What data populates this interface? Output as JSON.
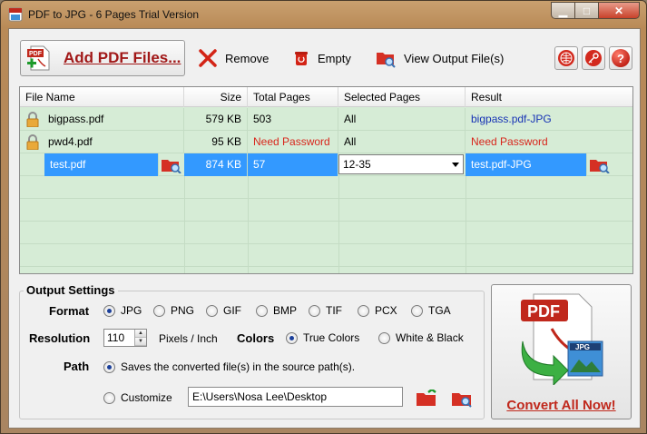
{
  "window": {
    "title": "PDF to JPG - 6 Pages Trial Version",
    "minimize_glyph": "▁",
    "maximize_glyph": "□",
    "close_glyph": "✕"
  },
  "toolbar": {
    "add_label": "Add PDF Files...",
    "remove_label": "Remove",
    "empty_label": "Empty",
    "view_output_label": "View Output File(s)",
    "help_glyph": "?"
  },
  "table": {
    "columns": [
      "File Name",
      "Size",
      "Total Pages",
      "Selected Pages",
      "Result"
    ],
    "rows": [
      {
        "file": "bigpass.pdf",
        "size": "579 KB",
        "total": "503",
        "selected": "All",
        "result": "bigpass.pdf-JPG",
        "locked": true
      },
      {
        "file": "pwd4.pdf",
        "size": "95 KB",
        "total": "Need Password",
        "selected": "All",
        "result": "Need Password",
        "locked": true
      },
      {
        "file": "test.pdf",
        "size": "874 KB",
        "total": "57",
        "selected": "12-35",
        "result": "test.pdf-JPG",
        "locked": false
      }
    ]
  },
  "settings": {
    "title": "Output Settings",
    "format_label": "Format",
    "formats": [
      "JPG",
      "PNG",
      "GIF",
      "BMP",
      "TIF",
      "PCX",
      "TGA"
    ],
    "selected_format": "JPG",
    "resolution_label": "Resolution",
    "resolution_value": "110",
    "resolution_unit": "Pixels / Inch",
    "colors_label": "Colors",
    "color_true": "True Colors",
    "color_bw": "White & Black",
    "path_label": "Path",
    "path_source": "Saves the converted file(s) in the source path(s).",
    "path_custom": "Customize",
    "path_value": "E:\\Users\\Nosa Lee\\Desktop"
  },
  "convert": {
    "label": "Convert All Now!",
    "pdf_badge": "PDF",
    "jpg_badge": "JPG"
  },
  "colors": {
    "accent_red": "#c0281c",
    "list_bg": "#d6ecd6",
    "selection": "#3399ff",
    "link_blue": "#1733b5"
  }
}
